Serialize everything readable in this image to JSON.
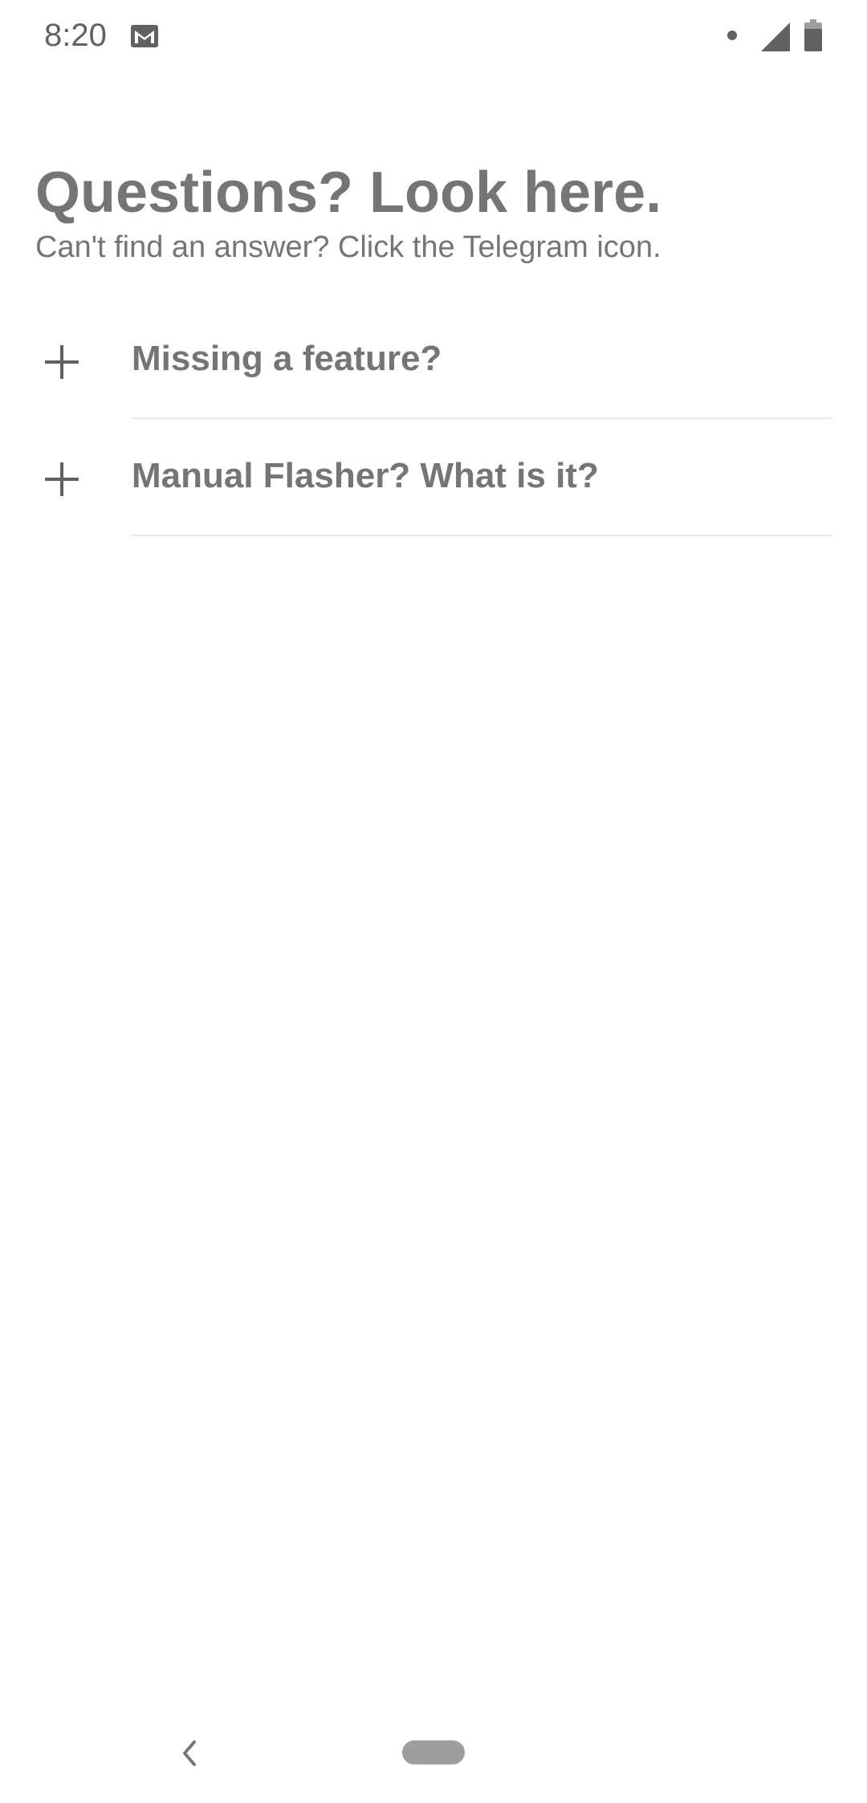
{
  "status_bar": {
    "time": "8:20",
    "icons": [
      "gmail-icon",
      "dot-icon",
      "signal-icon",
      "battery-icon"
    ]
  },
  "page": {
    "title": "Questions? Look here.",
    "subtitle": "Can't find an answer? Click the Telegram icon."
  },
  "faq": {
    "items": [
      {
        "question": "Missing a feature?",
        "icon": "plus-icon"
      },
      {
        "question": "Manual Flasher? What is it?",
        "icon": "plus-icon"
      }
    ]
  },
  "nav_bar": {
    "icons": [
      "back-icon",
      "home-pill"
    ]
  },
  "colors": {
    "text": "#757575",
    "status_icons": "#616161",
    "divider": "#e8e8e8",
    "home_pill": "#9e9e9e",
    "background": "#ffffff"
  }
}
